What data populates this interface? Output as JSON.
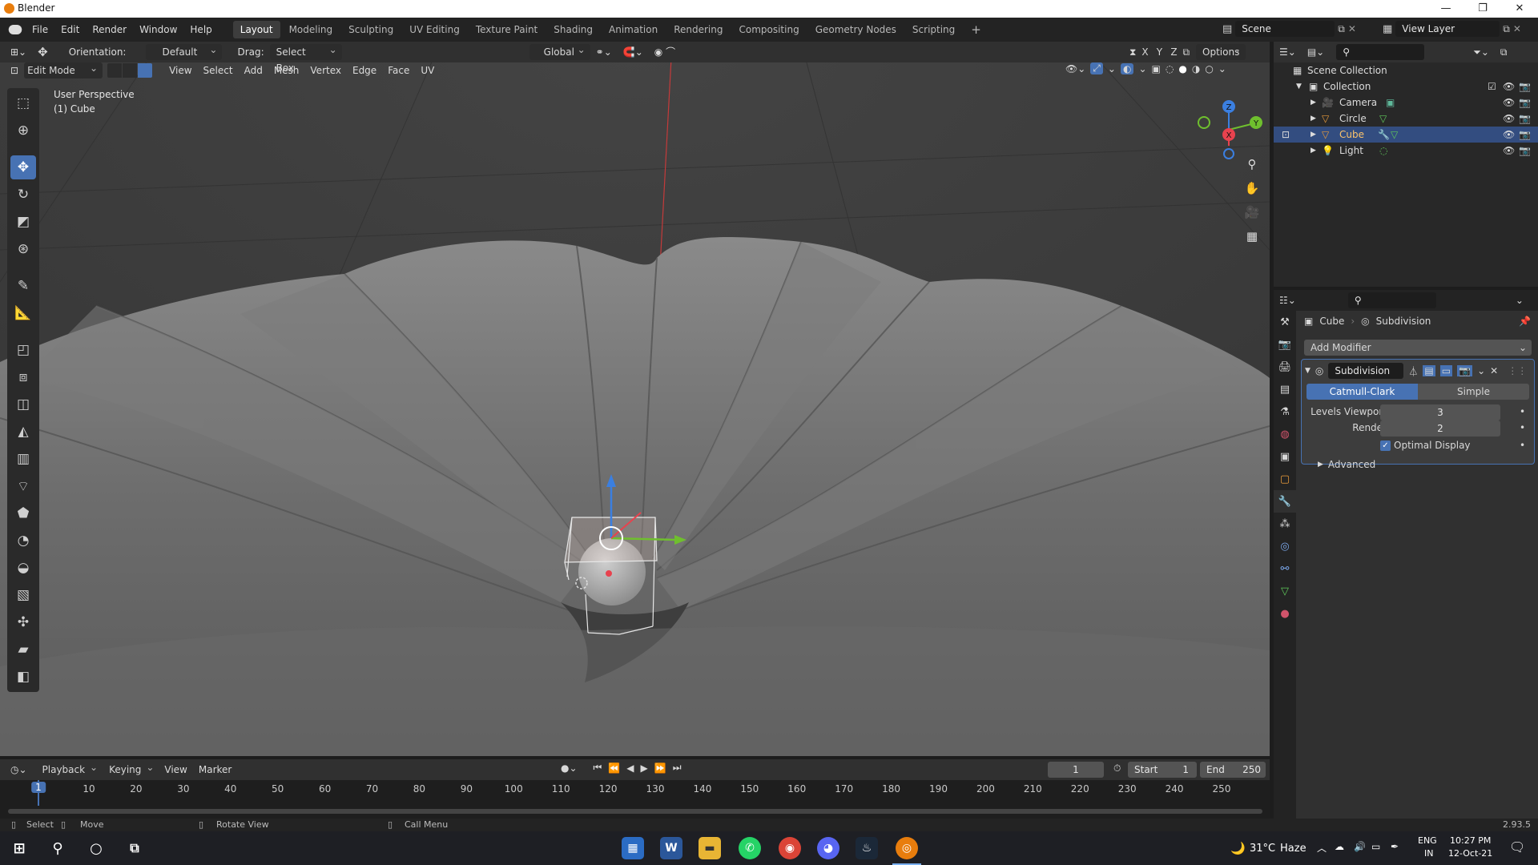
{
  "window": {
    "title": "Blender",
    "controls": [
      "—",
      "❐",
      "✕"
    ]
  },
  "menu": [
    "File",
    "Edit",
    "Render",
    "Window",
    "Help"
  ],
  "workspaces": [
    "Layout",
    "Modeling",
    "Sculpting",
    "UV Editing",
    "Texture Paint",
    "Shading",
    "Animation",
    "Rendering",
    "Compositing",
    "Geometry Nodes",
    "Scripting"
  ],
  "active_workspace": "Layout",
  "scene": {
    "name": "Scene",
    "view_layer": "View Layer"
  },
  "viewport_header": {
    "orientation_label": "Orientation:",
    "orientation_value": "Default",
    "drag_label": "Drag:",
    "drag_value": "Select Box",
    "transform_space": "Global",
    "options_label": "Options",
    "axes": [
      "X",
      "Y",
      "Z"
    ]
  },
  "mode_header": {
    "mode": "Edit Mode",
    "menus": [
      "View",
      "Select",
      "Add",
      "Mesh",
      "Vertex",
      "Edge",
      "Face",
      "UV"
    ]
  },
  "viewport_overlay": {
    "perspective": "User Perspective",
    "object": "(1) Cube"
  },
  "gizmo_axes": {
    "z": "Z",
    "y": "Y",
    "x": "X"
  },
  "outliner": {
    "root": "Scene Collection",
    "collection": "Collection",
    "items": [
      {
        "name": "Camera",
        "selected": false
      },
      {
        "name": "Circle",
        "selected": false
      },
      {
        "name": "Cube",
        "selected": true
      },
      {
        "name": "Light",
        "selected": false
      }
    ]
  },
  "properties": {
    "breadcrumb_object": "Cube",
    "breadcrumb_modifier": "Subdivision",
    "add_modifier": "Add Modifier",
    "modifier_name": "Subdivision",
    "mode_catmull": "Catmull-Clark",
    "mode_simple": "Simple",
    "levels_viewport_label": "Levels Viewport",
    "levels_viewport_value": "3",
    "render_label": "Render",
    "render_value": "2",
    "optimal_display": "Optimal Display",
    "advanced": "Advanced"
  },
  "timeline": {
    "menus": [
      "Playback",
      "Keying",
      "View",
      "Marker"
    ],
    "current_frame": "1",
    "start_label": "Start",
    "start_value": "1",
    "end_label": "End",
    "end_value": "250",
    "ruler_ticks": [
      "1",
      "10",
      "20",
      "30",
      "40",
      "50",
      "60",
      "70",
      "80",
      "90",
      "100",
      "110",
      "120",
      "130",
      "140",
      "150",
      "160",
      "170",
      "180",
      "190",
      "200",
      "210",
      "220",
      "230",
      "240",
      "250"
    ]
  },
  "statusbar": {
    "select": "Select",
    "move": "Move",
    "rotate": "Rotate View",
    "call_menu": "Call Menu",
    "version": "2.93.5"
  },
  "taskbar": {
    "weather_temp": "31°C",
    "weather_text": "Haze",
    "lang_top": "ENG",
    "lang_bottom": "IN",
    "time": "10:27 PM",
    "date": "12-Oct-21"
  },
  "colors": {
    "accent": "#4772b3",
    "selection": "#334d80",
    "x_axis": "#e8424e",
    "y_axis": "#6fbf2e",
    "z_axis": "#3b7fe0"
  }
}
